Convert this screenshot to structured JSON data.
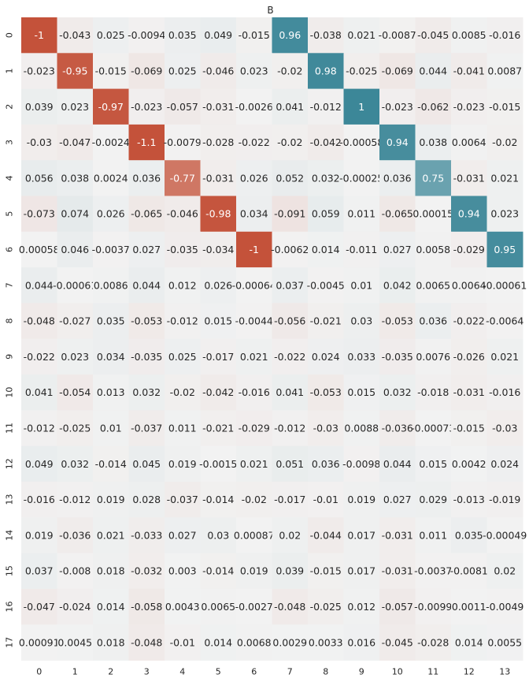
{
  "chart_data": {
    "type": "heatmap",
    "title": "B",
    "xlabel": "",
    "ylabel": "",
    "x_labels": [
      "0",
      "1",
      "2",
      "3",
      "4",
      "5",
      "6",
      "7",
      "8",
      "9",
      "10",
      "11",
      "12",
      "13"
    ],
    "y_labels": [
      "0",
      "1",
      "2",
      "3",
      "4",
      "5",
      "6",
      "7",
      "8",
      "9",
      "10",
      "11",
      "12",
      "13",
      "14",
      "15",
      "16",
      "17"
    ],
    "color_range": [
      -1,
      1
    ],
    "colors": {
      "negative": "#c4523a",
      "neutral": "#f2f2f2",
      "positive": "#3c8798",
      "light_text": "#ffffff",
      "dark_text": "#262626"
    },
    "cells": [
      [
        "-1",
        "-0.043",
        "0.025",
        "-0.0094",
        "0.035",
        "0.049",
        "-0.015",
        "0.96",
        "-0.038",
        "0.021",
        "-0.0087",
        "-0.045",
        "0.0085",
        "-0.016"
      ],
      [
        "-0.023",
        "-0.95",
        "-0.015",
        "-0.069",
        "0.025",
        "-0.046",
        "0.023",
        "-0.02",
        "0.98",
        "-0.025",
        "-0.069",
        "0.044",
        "-0.041",
        "0.0087"
      ],
      [
        "0.039",
        "0.023",
        "-0.97",
        "-0.023",
        "-0.057",
        "-0.031",
        "-0.0026",
        "0.041",
        "-0.012",
        "1",
        "-0.023",
        "-0.062",
        "-0.023",
        "-0.015"
      ],
      [
        "-0.03",
        "-0.047",
        "-0.0024",
        "-1.1",
        "-0.0079",
        "-0.028",
        "-0.022",
        "-0.02",
        "-0.042",
        "-0.00058",
        "0.94",
        "0.038",
        "0.0064",
        "-0.02"
      ],
      [
        "0.056",
        "0.038",
        "0.0024",
        "0.036",
        "-0.77",
        "-0.031",
        "0.026",
        "0.052",
        "0.032",
        "-0.00025",
        "0.036",
        "0.75",
        "-0.031",
        "0.021"
      ],
      [
        "-0.073",
        "0.074",
        "0.026",
        "-0.065",
        "-0.046",
        "-0.98",
        "0.034",
        "-0.091",
        "0.059",
        "0.011",
        "-0.065",
        "0.00015",
        "0.94",
        "0.023"
      ],
      [
        "0.00058",
        "0.046",
        "-0.0037",
        "0.027",
        "-0.035",
        "-0.034",
        "-1",
        "-0.0062",
        "0.014",
        "-0.011",
        "0.027",
        "0.0058",
        "-0.029",
        "0.95"
      ],
      [
        "0.044",
        "-0.00061",
        "0.0086",
        "0.044",
        "0.012",
        "0.026",
        "-0.00064",
        "0.037",
        "-0.0045",
        "0.01",
        "0.042",
        "0.0065",
        "0.0064",
        "-0.00061"
      ],
      [
        "-0.048",
        "-0.027",
        "0.035",
        "-0.053",
        "-0.012",
        "0.015",
        "-0.0044",
        "-0.056",
        "-0.021",
        "0.03",
        "-0.053",
        "0.036",
        "-0.022",
        "-0.0064"
      ],
      [
        "-0.022",
        "0.023",
        "0.034",
        "-0.035",
        "0.025",
        "-0.017",
        "0.021",
        "-0.022",
        "0.024",
        "0.033",
        "-0.035",
        "0.0076",
        "-0.026",
        "0.021"
      ],
      [
        "0.041",
        "-0.054",
        "0.013",
        "0.032",
        "-0.02",
        "-0.042",
        "-0.016",
        "0.041",
        "-0.053",
        "0.015",
        "0.032",
        "-0.018",
        "-0.031",
        "-0.016"
      ],
      [
        "-0.012",
        "-0.025",
        "0.01",
        "-0.037",
        "0.011",
        "-0.021",
        "-0.029",
        "-0.012",
        "-0.03",
        "0.0088",
        "-0.036",
        "-0.00073",
        "-0.015",
        "-0.03"
      ],
      [
        "0.049",
        "0.032",
        "-0.014",
        "0.045",
        "0.019",
        "-0.0015",
        "0.021",
        "0.051",
        "0.036",
        "-0.0098",
        "0.044",
        "0.015",
        "0.0042",
        "0.024"
      ],
      [
        "-0.016",
        "-0.012",
        "0.019",
        "0.028",
        "-0.037",
        "-0.014",
        "-0.02",
        "-0.017",
        "-0.01",
        "0.019",
        "0.027",
        "0.029",
        "-0.013",
        "-0.019"
      ],
      [
        "0.019",
        "-0.036",
        "0.021",
        "-0.033",
        "0.027",
        "0.03",
        "0.00087",
        "0.02",
        "-0.044",
        "0.017",
        "-0.031",
        "0.011",
        "0.035",
        "-0.00049"
      ],
      [
        "0.037",
        "-0.008",
        "0.018",
        "-0.032",
        "0.003",
        "-0.014",
        "0.019",
        "0.039",
        "-0.015",
        "0.017",
        "-0.031",
        "-0.0037",
        "-0.0081",
        "0.02"
      ],
      [
        "-0.047",
        "-0.024",
        "0.014",
        "-0.058",
        "0.0043",
        "0.0065",
        "-0.0027",
        "-0.048",
        "-0.025",
        "0.012",
        "-0.057",
        "-0.0099",
        "0.0011",
        "-0.0049"
      ],
      [
        "0.00091",
        "0.0045",
        "0.018",
        "-0.048",
        "-0.01",
        "0.014",
        "0.0068",
        "0.0029",
        "0.0033",
        "0.016",
        "-0.045",
        "-0.028",
        "0.014",
        "0.0055"
      ]
    ]
  }
}
